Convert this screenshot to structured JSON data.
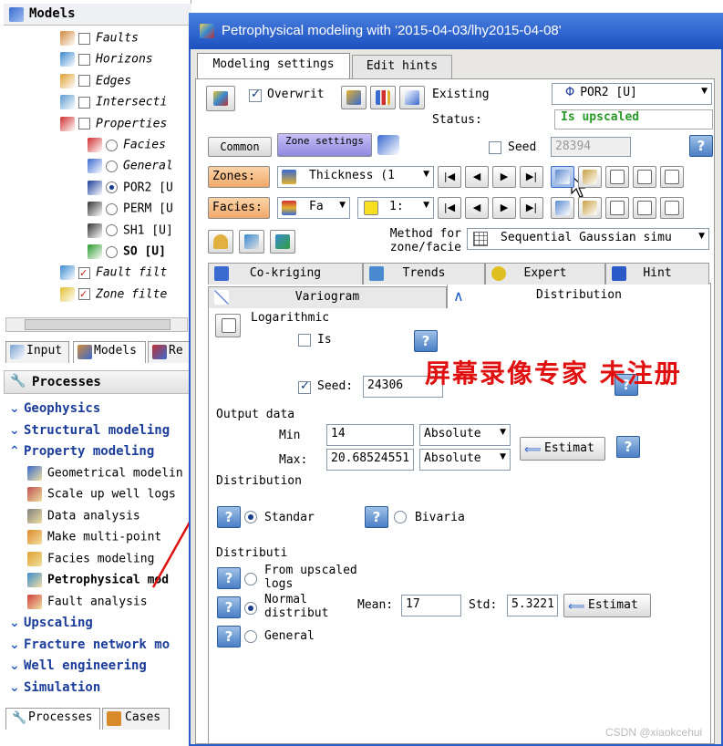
{
  "left_panel": {
    "models_title": "Models",
    "tree": [
      {
        "label": "Faults",
        "indent": 1
      },
      {
        "label": "Horizons",
        "indent": 1
      },
      {
        "label": "Edges",
        "indent": 1
      },
      {
        "label": "Intersecti",
        "indent": 1
      },
      {
        "label": "Properties",
        "indent": 1
      },
      {
        "label": "Facies",
        "indent": 2
      },
      {
        "label": "General",
        "indent": 2
      },
      {
        "label": "POR2 [U",
        "indent": 2
      },
      {
        "label": "PERM [U",
        "indent": 2
      },
      {
        "label": "SH1 [U]",
        "indent": 2
      },
      {
        "label": "SO [U]",
        "indent": 2
      },
      {
        "label": "Fault filt",
        "indent": 1
      },
      {
        "label": "Zone filte",
        "indent": 1
      }
    ],
    "top_tabs": [
      "Input",
      "Models",
      "Re"
    ],
    "processes_title": "Processes",
    "processes": [
      {
        "label": "Geophysics",
        "expanded": false
      },
      {
        "label": "Structural modeling",
        "expanded": false
      },
      {
        "label": "Property modeling",
        "expanded": true
      }
    ],
    "property_items": [
      "Geometrical modelin",
      "Scale up well logs",
      "Data analysis",
      "Make multi-point",
      "Facies modeling",
      "Petrophysical mod",
      "Fault analysis"
    ],
    "processes_more": [
      "Upscaling",
      "Fracture network mo",
      "Well engineering",
      "Simulation"
    ],
    "bottom_tabs": [
      "Processes",
      "Cases"
    ]
  },
  "dialog": {
    "title": "Petrophysical modeling with '2015-04-03/lhy2015-04-08'",
    "main_tabs": [
      "Modeling settings",
      "Edit hints"
    ],
    "overwrite_label": "Overwrit",
    "existing_label": "Existing",
    "existing_value": "POR2 [U]",
    "status_label": "Status:",
    "status_value": "Is upscaled",
    "common_button": "Common",
    "zone_settings_button": "Zone settings",
    "seed_label": "Seed",
    "seed_value": "28394",
    "zones_label": "Zones:",
    "zones_value": "Thickness (1",
    "facies_label": "Facies:",
    "facies_value": "Fa",
    "facies_value2": "1:",
    "method_label": "Method for zone/facie",
    "method_value": "Sequential Gaussian simu",
    "method_tabs_row1": [
      "Co-kriging",
      "Trends",
      "Expert",
      "Hint"
    ],
    "method_tabs_row2": [
      "Variogram",
      "Distribution"
    ],
    "logarithmic_label": "Logarithmic",
    "is_label": "Is",
    "seed2_label": "Seed:",
    "seed2_value": "24306",
    "watermark": "屏幕录像专家 未注册",
    "output_data_label": "Output data",
    "min_label": "Min",
    "min_value": "14",
    "min_mode": "Absolute",
    "max_label": "Max:",
    "max_value": "20.68524551",
    "max_mode": "Absolute",
    "estimate_button": "Estimat",
    "distribution_label": "Distribution",
    "standard_label": "Standar",
    "bivariate_label": "Bivaria",
    "distributi_label": "Distributi",
    "from_upscaled_label": "From upscaled logs",
    "normal_label": "Normal distribut",
    "mean_label": "Mean:",
    "mean_value": "17",
    "std_label": "Std:",
    "std_value": "5.3221",
    "estimate_button2": "Estimat",
    "general_label": "General"
  },
  "credit": "CSDN @xiaokcehui",
  "colors": {
    "title_bar": "#2a60c8",
    "process_text": "#1a3c9a",
    "status_green": "#2a9a2a",
    "watermark_red": "#e01010",
    "zones_orange": "#f6c08a",
    "zone_settings": "#a8a0e8"
  }
}
